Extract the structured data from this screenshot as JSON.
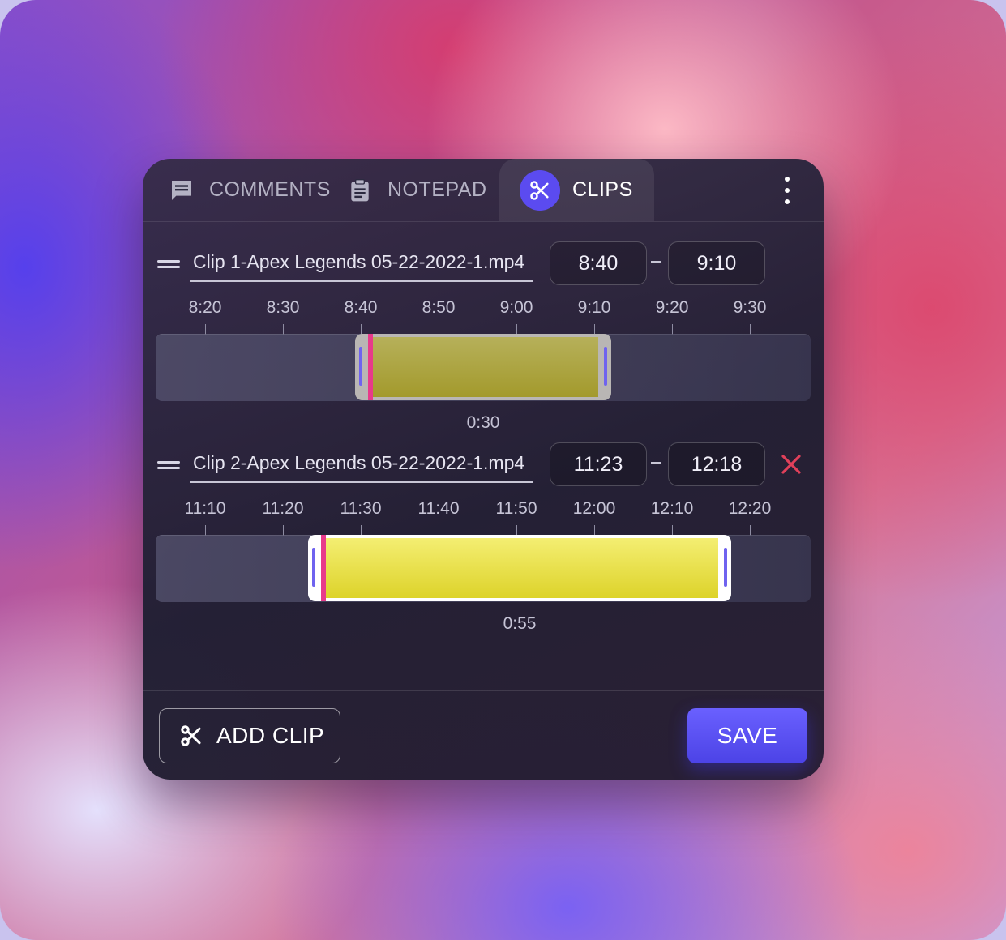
{
  "tabs": {
    "comments": {
      "label": "COMMENTS",
      "icon": "comment-icon"
    },
    "notepad": {
      "label": "NOTEPAD",
      "icon": "clipboard-icon"
    },
    "clips": {
      "label": "CLIPS",
      "icon": "scissors-icon",
      "active": true
    },
    "menu_icon": "more-vertical-icon"
  },
  "clips": [
    {
      "name": "Clip 1-Apex Legends 05-22-2022-1.mp4",
      "start": "8:40",
      "end": "9:10",
      "ticks": [
        "8:20",
        "8:30",
        "8:40",
        "8:50",
        "9:00",
        "9:10",
        "9:20",
        "9:30"
      ],
      "duration": "0:30",
      "removable": false
    },
    {
      "name": "Clip 2-Apex Legends 05-22-2022-1.mp4",
      "start": "11:23",
      "end": "12:18",
      "ticks": [
        "11:10",
        "11:20",
        "11:30",
        "11:40",
        "11:50",
        "12:00",
        "12:10",
        "12:20"
      ],
      "duration": "0:55",
      "removable": true,
      "remove_icon": "close-icon"
    }
  ],
  "footer": {
    "add_clip_label": "ADD CLIP",
    "add_clip_icon": "scissors-icon",
    "save_label": "SAVE"
  },
  "colors": {
    "accent": "#5b4bf0",
    "clip_fill_active": "#e8e040",
    "clip_fill_inactive": "#aaa23a",
    "playhead": "#e83a8a",
    "remove": "#e0405a"
  }
}
